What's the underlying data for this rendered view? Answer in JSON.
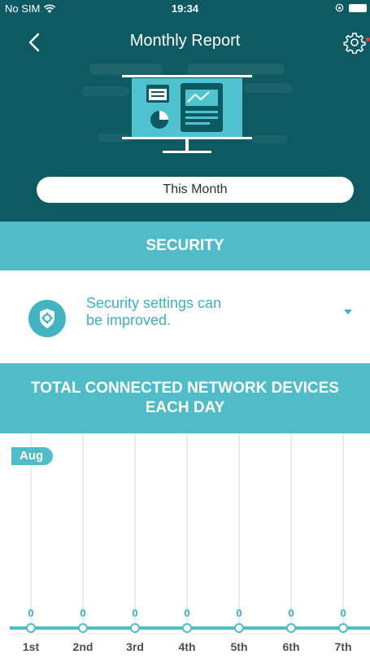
{
  "status_bar": {
    "carrier": "No SIM",
    "time": "19:34"
  },
  "header": {
    "title": "Monthly Report",
    "back_icon": "chevron-left-icon",
    "settings_icon": "gear-icon"
  },
  "period_button": {
    "label": "This Month"
  },
  "security": {
    "section_title": "SECURITY",
    "message_line1": "Security settings can",
    "message_line2": "be improved.",
    "icon": "shield-gear-icon"
  },
  "devices": {
    "section_title_line1": "TOTAL CONNECTED NETWORK DEVICES",
    "section_title_line2": "EACH DAY"
  },
  "colors": {
    "header_bg": "#0e5a63",
    "accent": "#4fbcc8",
    "text_accent": "#3fb0bf"
  },
  "chart_data": {
    "type": "line",
    "month_label": "Aug",
    "categories": [
      "1st",
      "2nd",
      "3rd",
      "4th",
      "5th",
      "6th",
      "7th"
    ],
    "values": [
      0,
      0,
      0,
      0,
      0,
      0,
      0
    ]
  }
}
